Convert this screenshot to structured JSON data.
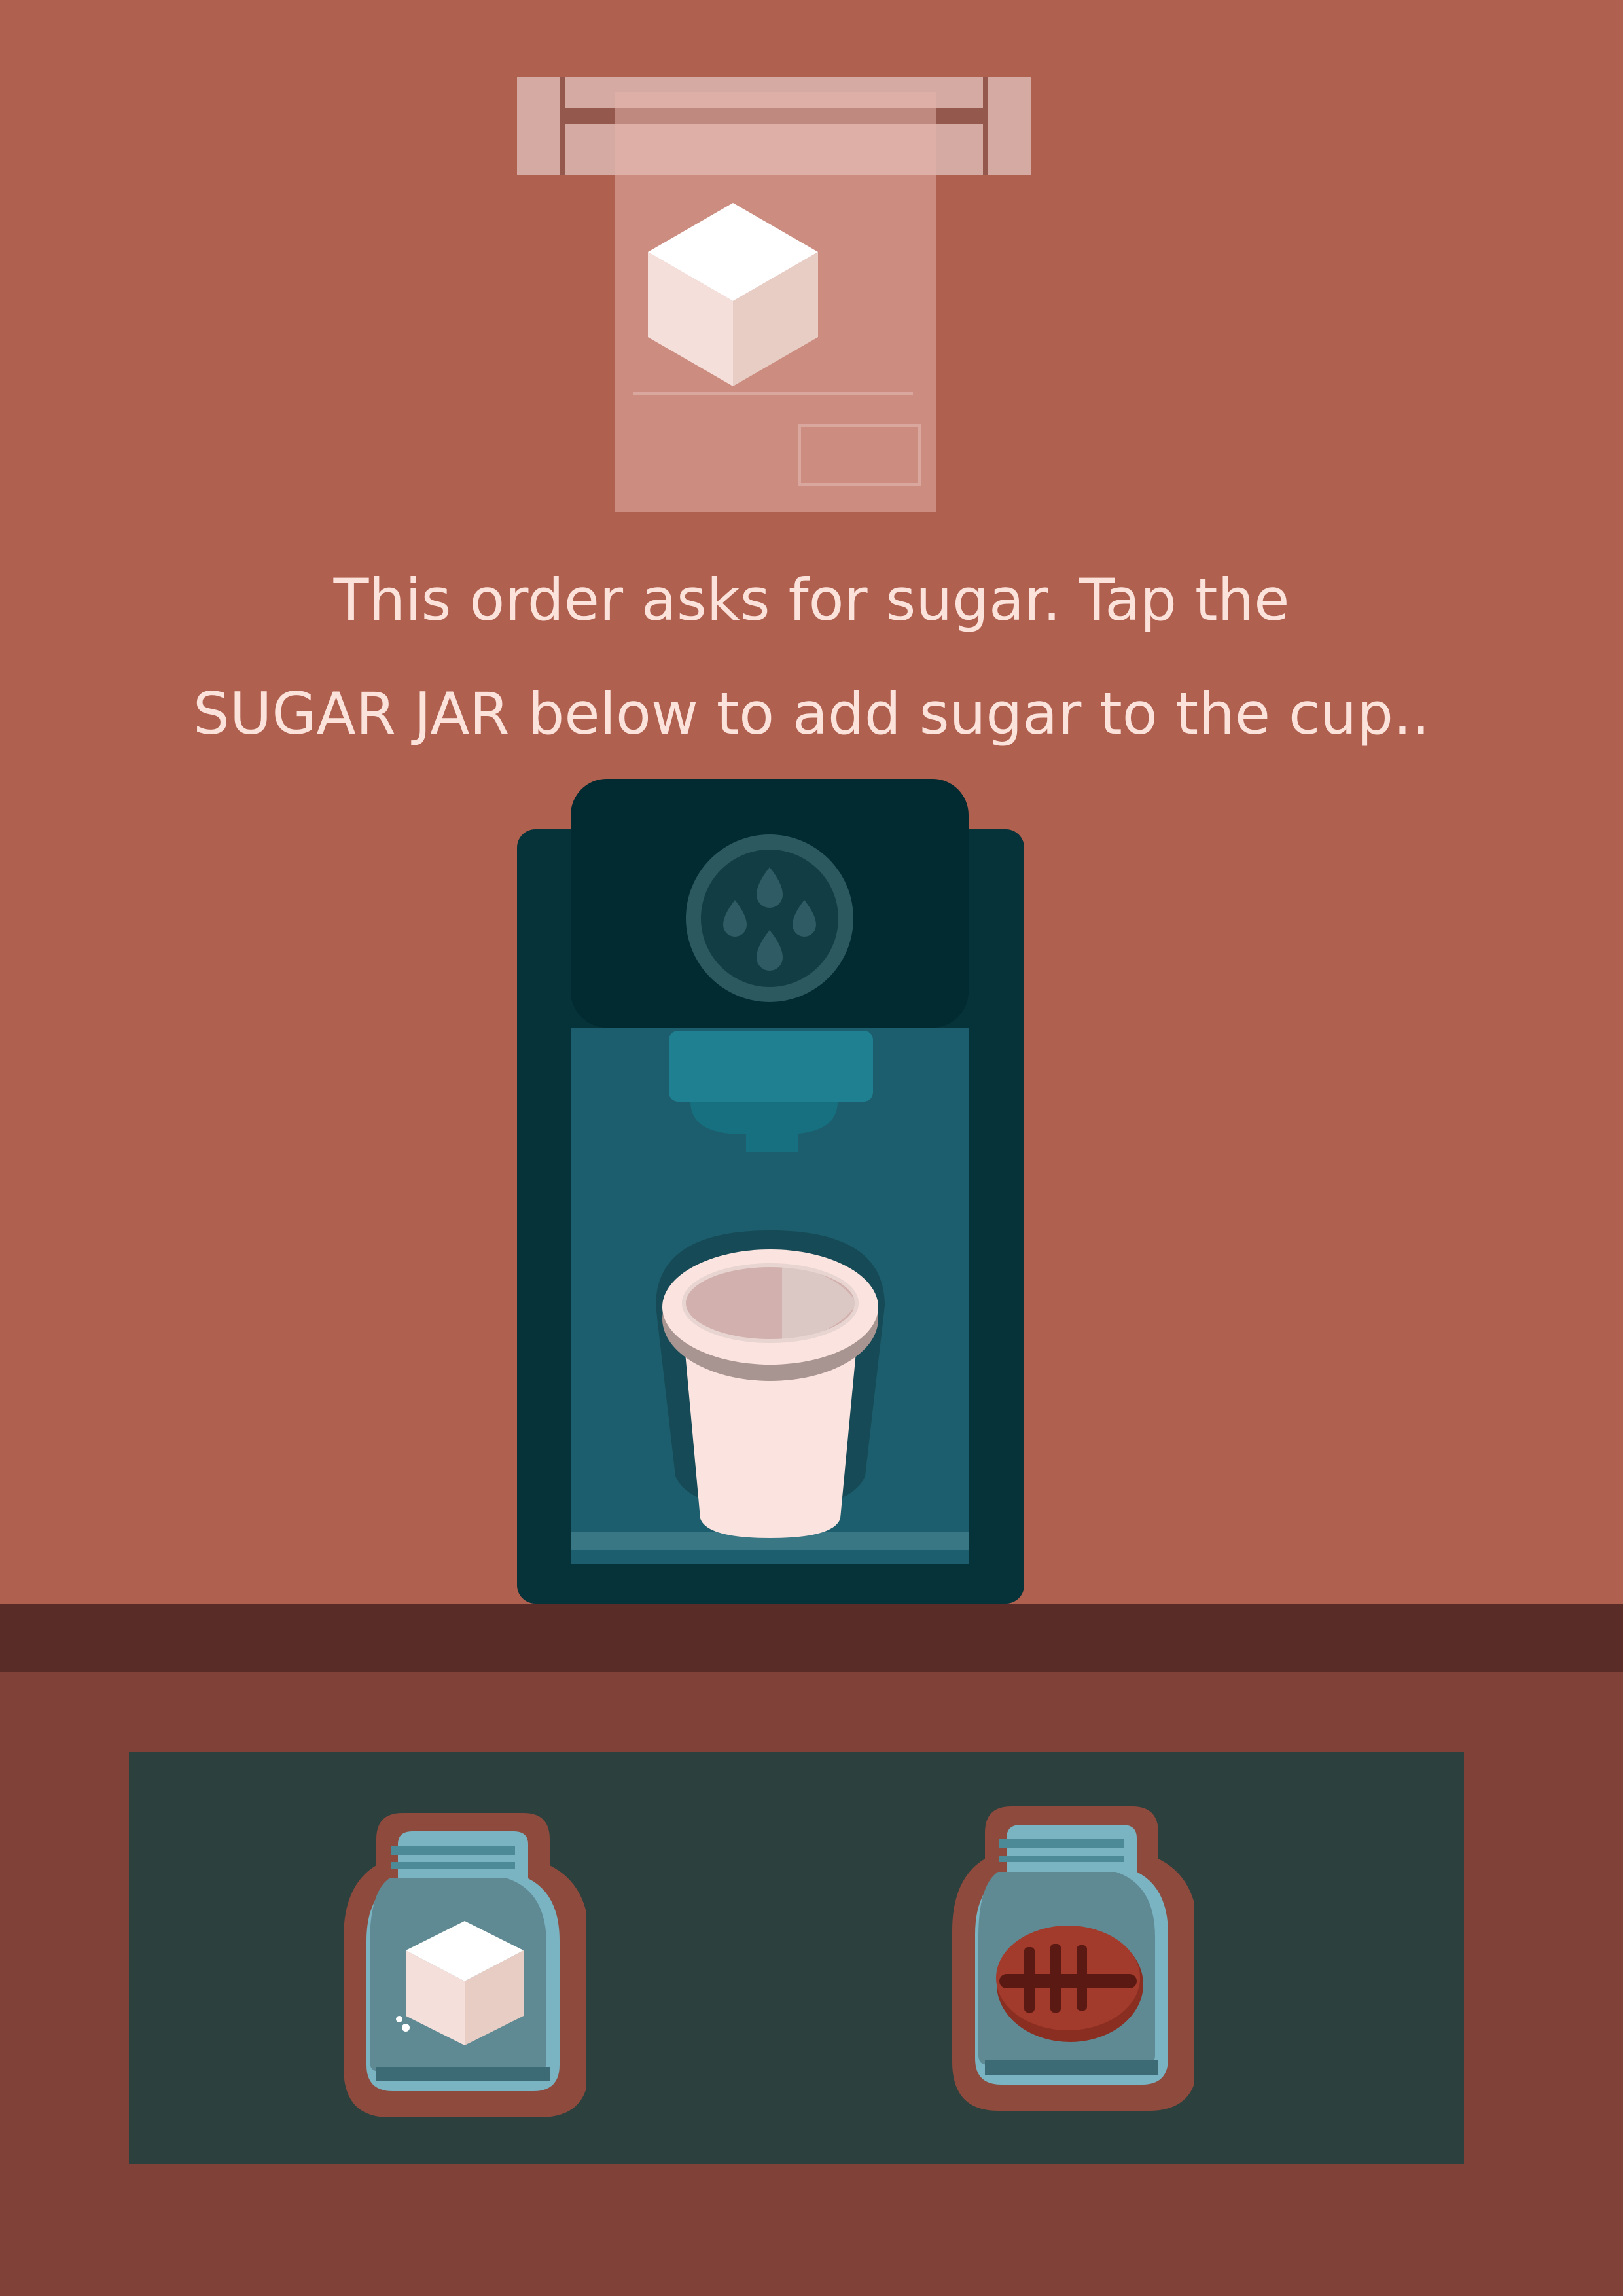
{
  "instruction": {
    "line1": "This order asks for sugar. Tap the",
    "line2": "SUGAR JAR below to add sugar to the cup.."
  },
  "order_ticket": {
    "ingredient_icon": "sugar-cube-icon"
  },
  "machine": {
    "indicator_icon": "water-drops-icon",
    "cup": "empty-cup"
  },
  "jars": [
    {
      "name": "sugar-jar",
      "icon": "sugar-cube-icon"
    },
    {
      "name": "coffee-jar",
      "icon": "coffee-bean-icon"
    }
  ],
  "colors": {
    "background": "#b0604f",
    "counter_top": "#5a2c27",
    "counter_front": "#7f4138",
    "shelf": "#2c403e",
    "machine_body": "#06333a",
    "jar_glass": "#7ab3c1",
    "text": "#fbe3dc"
  }
}
